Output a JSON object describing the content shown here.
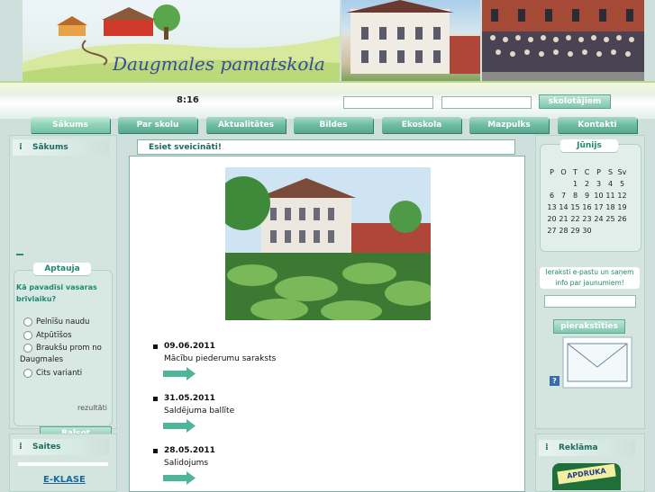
{
  "header": {
    "logo_text": "Daugmales pamatskola",
    "time": "8:16",
    "teacher_button": "skolotājiem"
  },
  "nav": [
    "Sākums",
    "Par skolu",
    "Aktualitātes",
    "Bildes",
    "Ekoskola",
    "Mazpulks",
    "Kontakti"
  ],
  "left": {
    "home_title": "Sākums",
    "survey_title": "Aptauja",
    "survey_question": "Kā pavadīsi vasaras brīvlaiku?",
    "options": [
      "Pelnīšu naudu",
      "Atpūtīšos",
      "Braukšu prom no Daugmales",
      "Cits varianti"
    ],
    "results_link": "rezultāti",
    "vote_button": "Balsot",
    "links_title": "Saites",
    "link_1": "E-KLASE"
  },
  "main": {
    "welcome": "Esiet sveicināti!",
    "news": [
      {
        "date": "09.06.2011",
        "title": "Mācību piederumu saraksts"
      },
      {
        "date": "31.05.2011",
        "title": "Saldējuma ballīte"
      },
      {
        "date": "28.05.2011",
        "title": "Salidojums"
      }
    ]
  },
  "right": {
    "month": "Jūnijs",
    "weekdays": [
      "P",
      "O",
      "T",
      "C",
      "P",
      "S",
      "Sv"
    ],
    "weeks": [
      [
        "",
        "",
        "1",
        "2",
        "3",
        "4",
        "5"
      ],
      [
        "6",
        "7",
        "8",
        "9",
        "10",
        "11",
        "12"
      ],
      [
        "13",
        "14",
        "15",
        "16",
        "17",
        "18",
        "19"
      ],
      [
        "20",
        "21",
        "22",
        "23",
        "24",
        "25",
        "26"
      ],
      [
        "27",
        "28",
        "29",
        "30",
        "",
        "",
        ""
      ]
    ],
    "subscribe_text": "Ieraksti e-pastu un saņem info par jaunumiem!",
    "subscribe_button": "pierakstīties",
    "help_icon_text": "?",
    "ads_title": "Reklāma",
    "ad_text": "APDRUKA"
  },
  "colors": {
    "accent": "#6cbca3",
    "panel": "#d4e5e0",
    "title_text": "#1d6a5f"
  }
}
